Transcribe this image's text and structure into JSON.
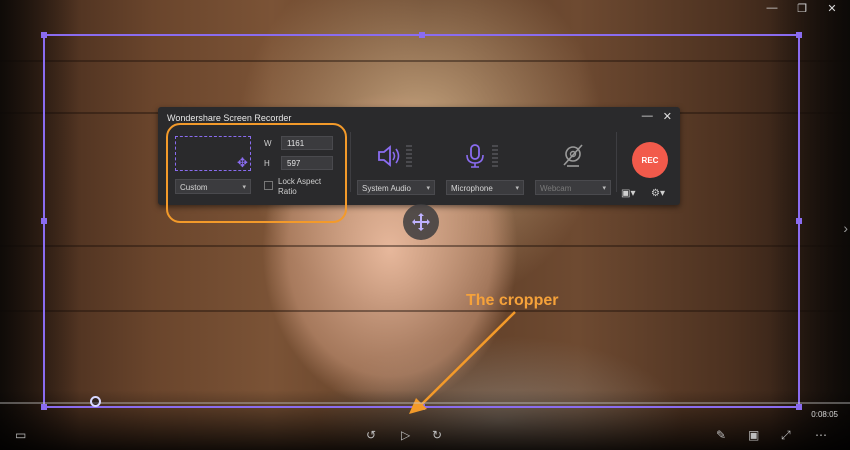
{
  "window_controls": {
    "minimize": "—",
    "restore": "❐",
    "close": "✕"
  },
  "recorder": {
    "title": "Wondershare Screen Recorder",
    "minimize": "—",
    "close": "✕",
    "region_preset": "Custom",
    "width_label": "W",
    "width_value": "1161",
    "height_label": "H",
    "height_value": "597",
    "lock_aspect_label": "Lock Aspect Ratio",
    "system_audio": "System Audio",
    "microphone": "Microphone",
    "webcam": "Webcam",
    "rec_label": "REC"
  },
  "annotation": {
    "cropper_label": "The cropper"
  },
  "player": {
    "time": "0:08:05"
  },
  "colors": {
    "accent": "#8a6cf0",
    "annotation": "#f39a2a",
    "rec": "#f25a4b"
  }
}
